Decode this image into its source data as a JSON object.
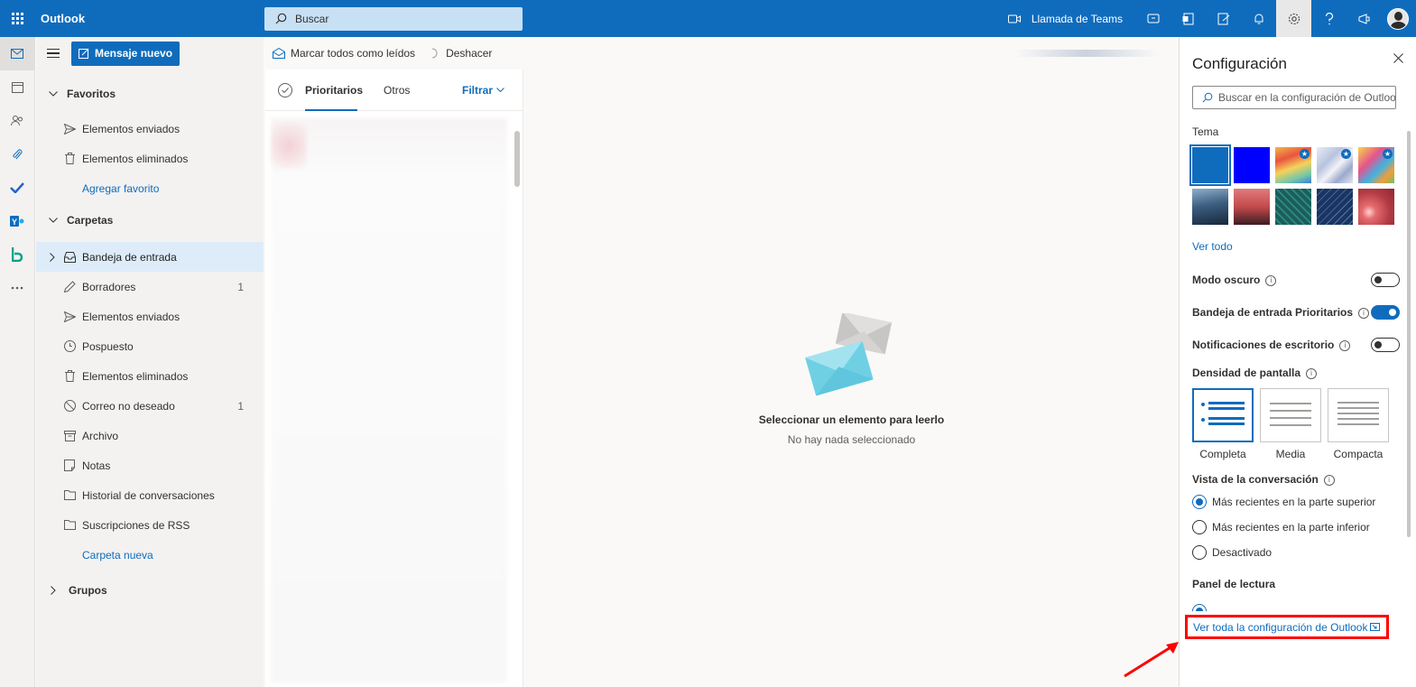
{
  "topbar": {
    "app_title": "Outlook",
    "search_placeholder": "Buscar",
    "teams_call": "Llamada de Teams",
    "icons": [
      "video-icon",
      "skype-icon",
      "office-icon",
      "feedback-icon",
      "bell-icon",
      "gear-icon",
      "help-icon",
      "megaphone-icon"
    ],
    "accent_color": "#0f6cbd"
  },
  "rail": {
    "icons": [
      "mail-icon",
      "calendar-icon",
      "people-icon",
      "paperclip-icon",
      "todo-icon",
      "yammer-icon",
      "bookings-icon",
      "more-icon"
    ]
  },
  "folders": {
    "new_message": "Mensaje nuevo",
    "favorites_label": "Favoritos",
    "favorites": [
      {
        "label": "Elementos enviados",
        "icon": "send-icon"
      },
      {
        "label": "Elementos eliminados",
        "icon": "trash-icon"
      }
    ],
    "add_favorite": "Agregar favorito",
    "folders_label": "Carpetas",
    "items": [
      {
        "label": "Bandeja de entrada",
        "icon": "inbox-icon",
        "count": ""
      },
      {
        "label": "Borradores",
        "icon": "pencil-icon",
        "count": "1"
      },
      {
        "label": "Elementos enviados",
        "icon": "send-icon",
        "count": ""
      },
      {
        "label": "Pospuesto",
        "icon": "clock-icon",
        "count": ""
      },
      {
        "label": "Elementos eliminados",
        "icon": "trash-icon",
        "count": ""
      },
      {
        "label": "Correo no deseado",
        "icon": "blocked-icon",
        "count": "1"
      },
      {
        "label": "Archivo",
        "icon": "archive-icon",
        "count": ""
      },
      {
        "label": "Notas",
        "icon": "note-icon",
        "count": ""
      },
      {
        "label": "Historial de conversaciones",
        "icon": "folder-icon",
        "count": ""
      },
      {
        "label": "Suscripciones de RSS",
        "icon": "folder-icon",
        "count": ""
      }
    ],
    "new_folder": "Carpeta nueva",
    "groups_label": "Grupos"
  },
  "command_bar": {
    "mark_all_read": "Marcar todos como leídos",
    "undo": "Deshacer"
  },
  "message_list": {
    "tab_focused": "Prioritarios",
    "tab_other": "Otros",
    "filter": "Filtrar"
  },
  "reading_pane": {
    "empty_title": "Seleccionar un elemento para leerlo",
    "empty_subtitle": "No hay nada seleccionado"
  },
  "settings": {
    "title": "Configuración",
    "search_placeholder": "Buscar en la configuración de Outlook",
    "theme_label": "Tema",
    "themes": [
      {
        "name": "blue",
        "color": "#0f6cbd",
        "selected": true,
        "star": false
      },
      {
        "name": "bright-blue",
        "color": "#0000ff",
        "selected": false,
        "star": false
      },
      {
        "name": "rainbow",
        "color": "#e9a13b",
        "selected": false,
        "star": true
      },
      {
        "name": "abstract-waves",
        "color": "#c9d2e6",
        "selected": false,
        "star": true
      },
      {
        "name": "colorful",
        "color": "#e0548c",
        "selected": false,
        "star": true
      },
      {
        "name": "mountains",
        "color": "#2d4e6e",
        "selected": false,
        "star": false
      },
      {
        "name": "palms",
        "color": "#b4464a",
        "selected": false,
        "star": false
      },
      {
        "name": "circuit",
        "color": "#1f6e6a",
        "selected": false,
        "star": false
      },
      {
        "name": "blueprint",
        "color": "#1d3a66",
        "selected": false,
        "star": false
      },
      {
        "name": "bokeh",
        "color": "#c3494d",
        "selected": false,
        "star": false
      }
    ],
    "see_all": "Ver todo",
    "dark_mode": {
      "label": "Modo oscuro",
      "on": false
    },
    "focused_inbox": {
      "label": "Bandeja de entrada Prioritarios",
      "on": true
    },
    "desktop_notifications": {
      "label": "Notificaciones de escritorio",
      "on": false
    },
    "density_label": "Densidad de pantalla",
    "density_options": [
      {
        "label": "Completa",
        "selected": true
      },
      {
        "label": "Media",
        "selected": false
      },
      {
        "label": "Compacta",
        "selected": false
      }
    ],
    "conversation_label": "Vista de la conversación",
    "conversation_options": [
      {
        "label": "Más recientes en la parte superior",
        "selected": true
      },
      {
        "label": "Más recientes en la parte inferior",
        "selected": false
      },
      {
        "label": "Desactivado",
        "selected": false
      }
    ],
    "reading_pane_label": "Panel de lectura",
    "all_settings_link": "Ver toda la configuración de Outlook"
  }
}
